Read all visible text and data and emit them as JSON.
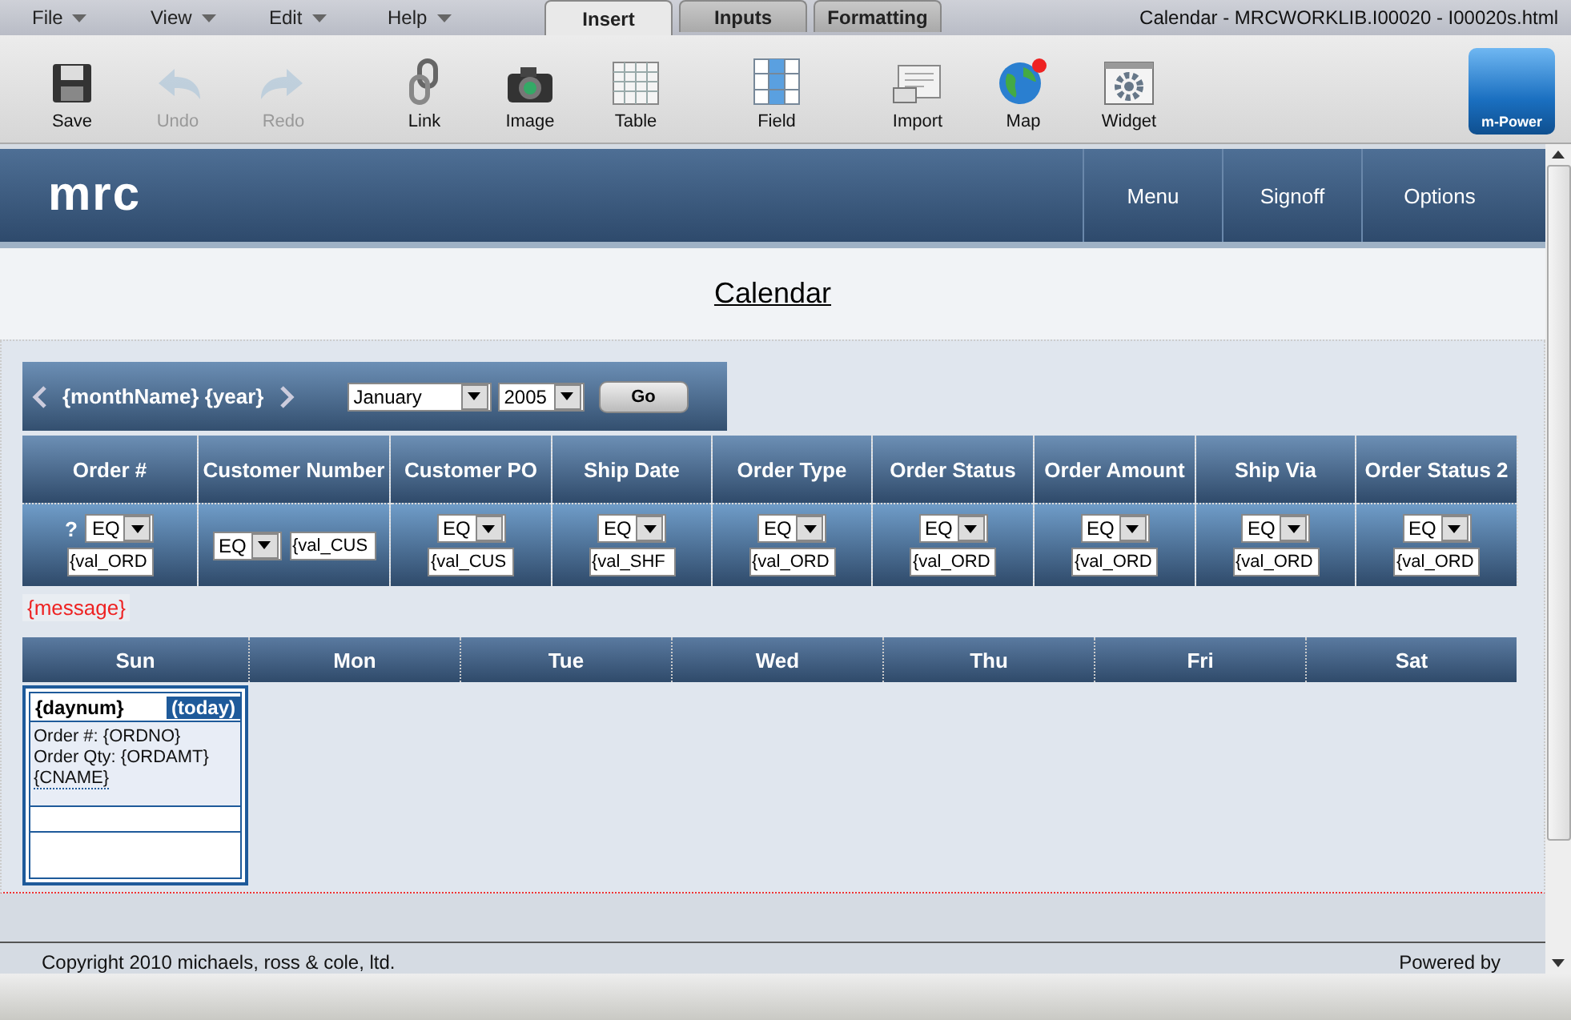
{
  "menu": [
    {
      "label": "File"
    },
    {
      "label": "View"
    },
    {
      "label": "Edit"
    },
    {
      "label": "Help"
    }
  ],
  "tabs": [
    {
      "label": "Insert",
      "selected": true
    },
    {
      "label": "Inputs",
      "selected": false
    },
    {
      "label": "Formatting",
      "selected": false
    }
  ],
  "window": {
    "title": "Calendar - MRCWORKLIB.I00020 - I00020s.html"
  },
  "toolbar": [
    {
      "kind": "save",
      "label": "Save",
      "disabled": false
    },
    {
      "kind": "undo",
      "label": "Undo",
      "disabled": true
    },
    {
      "kind": "redo",
      "label": "Redo",
      "disabled": true
    },
    {
      "kind": "link",
      "label": "Link",
      "disabled": false
    },
    {
      "kind": "image",
      "label": "Image",
      "disabled": false
    },
    {
      "kind": "table",
      "label": "Table",
      "disabled": false
    },
    {
      "kind": "field",
      "label": "Field",
      "disabled": false
    },
    {
      "kind": "import",
      "label": "Import",
      "disabled": false
    },
    {
      "kind": "map",
      "label": "Map",
      "disabled": false
    },
    {
      "kind": "widget",
      "label": "Widget",
      "disabled": false
    }
  ],
  "brand_button": {
    "label": "m-Power"
  },
  "header": {
    "logo": "mrc",
    "nav": [
      {
        "label": "Menu"
      },
      {
        "label": "Signoff"
      },
      {
        "label": "Options"
      }
    ]
  },
  "page_title": "Calendar",
  "month_nav": {
    "label": "{monthName} {year}",
    "month": "January",
    "year": "2005",
    "go": "Go"
  },
  "filter_columns": [
    {
      "label": "Order #",
      "kind": "stacked",
      "help": "?",
      "operator": "EQ",
      "value": "{val_ORD"
    },
    {
      "label": "Customer Number",
      "kind": "inline",
      "operator": "EQ",
      "value": "{val_CUS"
    },
    {
      "label": "Customer PO",
      "kind": "stacked",
      "operator": "EQ",
      "value": "{val_CUS"
    },
    {
      "label": "Ship Date",
      "kind": "stacked",
      "operator": "EQ",
      "value": "{val_SHF"
    },
    {
      "label": "Order Type",
      "kind": "stacked",
      "operator": "EQ",
      "value": "{val_ORD"
    },
    {
      "label": "Order Status",
      "kind": "stacked",
      "operator": "EQ",
      "value": "{val_ORD"
    },
    {
      "label": "Order Amount",
      "kind": "stacked",
      "operator": "EQ",
      "value": "{val_ORD"
    },
    {
      "label": "Ship Via",
      "kind": "stacked",
      "operator": "EQ",
      "value": "{val_ORD"
    },
    {
      "label": "Order Status 2",
      "kind": "stacked",
      "operator": "EQ",
      "value": "{val_ORD"
    }
  ],
  "message": "{message}",
  "weekdays": [
    "Sun",
    "Mon",
    "Tue",
    "Wed",
    "Thu",
    "Fri",
    "Sat"
  ],
  "day_cell": {
    "daynum": "{daynum}",
    "today": "(today)",
    "lines": [
      "Order #: {ORDNO}",
      "Order Qty: {ORDAMT}"
    ],
    "link": "{CNAME}"
  },
  "footer": {
    "copyright": "Copyright 2010 michaels, ross & cole, ltd.",
    "powered": "Powered by"
  }
}
